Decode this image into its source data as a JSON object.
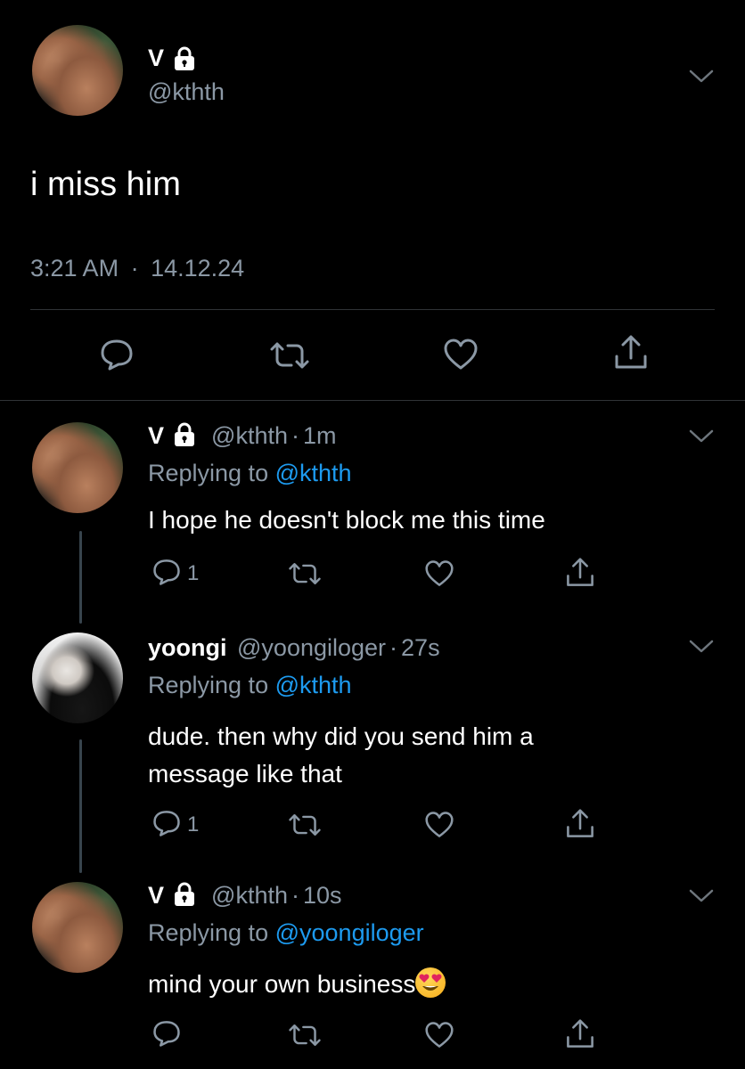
{
  "main_tweet": {
    "name": "V",
    "handle": "@kthth",
    "text": "i miss him",
    "time": "3:21 AM",
    "date": "14.12.24"
  },
  "replies": [
    {
      "name": "V",
      "handle": "@kthth",
      "age": "1m",
      "replying_label": "Replying to",
      "replying_to": "@kthth",
      "text": "I hope he doesn't block me this time",
      "reply_count": "1"
    },
    {
      "name": "yoongi",
      "handle": "@yoongiloger",
      "age": "27s",
      "replying_label": "Replying to",
      "replying_to": "@kthth",
      "text_line1": "dude. then why did you send him a",
      "text_line2": "message like that",
      "reply_count": "1"
    },
    {
      "name": "V",
      "handle": "@kthth",
      "age": "10s",
      "replying_label": "Replying to",
      "replying_to": "@yoongiloger",
      "text": "mind your own business"
    }
  ],
  "separator": "·",
  "colors": {
    "background": "#000000",
    "text": "#ffffff",
    "secondary": "#8b98a5",
    "link": "#1d9bf0",
    "divider": "#2f3336"
  }
}
